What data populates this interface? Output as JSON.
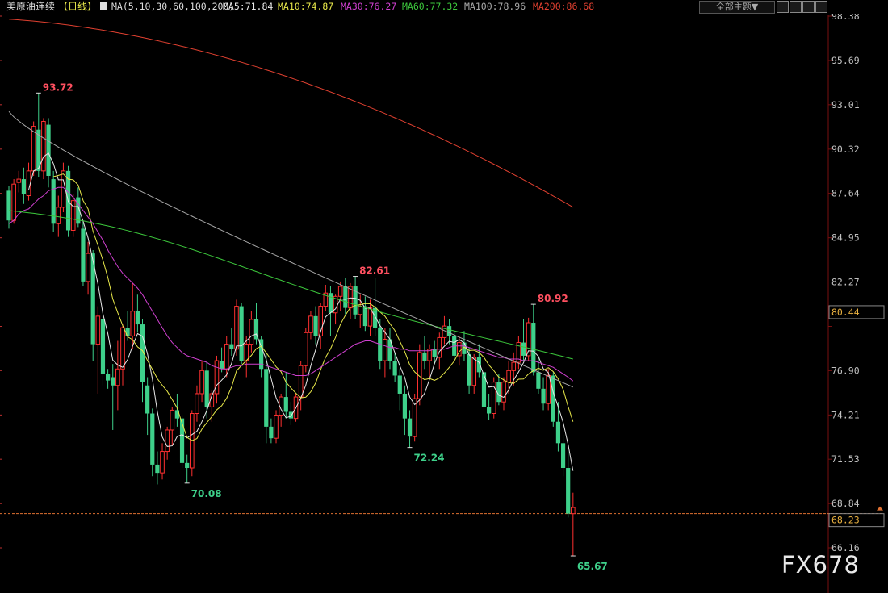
{
  "header": {
    "instrument": "美原油连续",
    "period": "【日线】",
    "ma_label": "MA(5,10,30,60,100,200)",
    "ma_values": [
      {
        "text": "MA5:71.84",
        "color": "#e8e8e8"
      },
      {
        "text": "MA10:74.87",
        "color": "#e8e84a"
      },
      {
        "text": "MA30:76.27",
        "color": "#d040d0"
      },
      {
        "text": "MA60:77.32",
        "color": "#3cc83c"
      },
      {
        "text": "MA100:78.96",
        "color": "#a8a8a8"
      },
      {
        "text": "MA200:86.68",
        "color": "#e04030"
      }
    ],
    "theme_select": "全部主题▼"
  },
  "watermark": "FX678",
  "chart_data": {
    "type": "candlestick",
    "instrument": "美原油连续",
    "period": "日线",
    "ylim": [
      64.5,
      99.5
    ],
    "y_ticks": [
      98.38,
      95.69,
      93.01,
      90.32,
      87.64,
      84.95,
      82.27,
      79.58,
      76.9,
      74.21,
      71.53,
      68.84,
      66.16
    ],
    "y_tick_labels": [
      "98.38",
      "95.69",
      "93.01",
      "90.32",
      "87.64",
      "84.95",
      "82.27",
      "",
      "76.90",
      "74.21",
      "71.53",
      "68.84",
      "66.16"
    ],
    "last_price": 68.23,
    "last_price_label": "68.23",
    "crosshair_price": 80.44,
    "crosshair_label": "80.44",
    "annotations": [
      {
        "label": "93.72",
        "bar": 6,
        "value": 93.72,
        "kind": "high"
      },
      {
        "label": "70.08",
        "bar": 36,
        "value": 70.08,
        "kind": "low"
      },
      {
        "label": "82.61",
        "bar": 70,
        "value": 82.61,
        "kind": "high"
      },
      {
        "label": "72.24",
        "bar": 81,
        "value": 72.24,
        "kind": "low"
      },
      {
        "label": "80.92",
        "bar": 106,
        "value": 80.92,
        "kind": "high"
      },
      {
        "label": "65.67",
        "bar": 114,
        "value": 65.67,
        "kind": "low"
      }
    ],
    "ohlc": [
      [
        87.8,
        88.1,
        85.5,
        86.0
      ],
      [
        86.0,
        88.5,
        85.8,
        88.2
      ],
      [
        88.3,
        89.0,
        87.7,
        88.5
      ],
      [
        88.5,
        89.2,
        87.0,
        87.6
      ],
      [
        87.5,
        89.5,
        87.2,
        89.0
      ],
      [
        89.0,
        92.0,
        88.7,
        91.7
      ],
      [
        91.5,
        93.72,
        88.6,
        89.0
      ],
      [
        89.0,
        92.2,
        88.5,
        92.0
      ],
      [
        91.8,
        92.2,
        88.0,
        88.7
      ],
      [
        88.5,
        89.0,
        85.3,
        85.8
      ],
      [
        85.8,
        87.5,
        85.0,
        86.8
      ],
      [
        86.8,
        89.5,
        86.5,
        89.0
      ],
      [
        89.0,
        89.3,
        85.0,
        85.4
      ],
      [
        85.4,
        87.6,
        85.0,
        87.2
      ],
      [
        87.4,
        88.0,
        85.6,
        85.8
      ],
      [
        85.5,
        86.0,
        82.0,
        82.3
      ],
      [
        82.3,
        84.7,
        81.5,
        84.0
      ],
      [
        84.0,
        84.2,
        77.5,
        78.5
      ],
      [
        78.5,
        80.8,
        75.5,
        80.2
      ],
      [
        80.0,
        80.6,
        76.0,
        76.7
      ],
      [
        76.7,
        77.0,
        75.8,
        76.3
      ],
      [
        76.5,
        77.3,
        73.3,
        76.0
      ],
      [
        76.0,
        78.7,
        74.5,
        77.0
      ],
      [
        77.0,
        79.7,
        76.0,
        79.5
      ],
      [
        79.5,
        80.5,
        78.7,
        79.0
      ],
      [
        79.0,
        82.2,
        78.2,
        80.5
      ],
      [
        80.5,
        81.5,
        79.2,
        79.7
      ],
      [
        79.7,
        80.0,
        75.0,
        76.2
      ],
      [
        76.0,
        76.5,
        73.0,
        74.3
      ],
      [
        74.3,
        74.6,
        70.5,
        71.2
      ],
      [
        71.2,
        72.0,
        70.0,
        70.7
      ],
      [
        70.7,
        72.5,
        70.3,
        72.0
      ],
      [
        72.0,
        73.5,
        71.5,
        73.3
      ],
      [
        73.3,
        74.7,
        72.4,
        74.5
      ],
      [
        74.5,
        75.5,
        73.5,
        74.0
      ],
      [
        74.0,
        74.2,
        71.0,
        71.3
      ],
      [
        71.3,
        71.8,
        70.08,
        71.0
      ],
      [
        71.0,
        74.5,
        70.5,
        74.3
      ],
      [
        74.3,
        76.0,
        73.8,
        75.5
      ],
      [
        75.5,
        77.5,
        75.0,
        76.9
      ],
      [
        76.9,
        77.5,
        74.0,
        74.7
      ],
      [
        74.7,
        75.7,
        73.8,
        75.5
      ],
      [
        75.5,
        77.8,
        74.9,
        77.5
      ],
      [
        77.5,
        78.3,
        76.8,
        77.0
      ],
      [
        77.0,
        79.0,
        76.5,
        78.5
      ],
      [
        78.5,
        79.5,
        77.8,
        78.2
      ],
      [
        78.2,
        81.2,
        77.8,
        80.8
      ],
      [
        80.8,
        81.0,
        77.3,
        77.5
      ],
      [
        77.5,
        79.0,
        76.5,
        78.5
      ],
      [
        78.5,
        80.5,
        78.0,
        80.0
      ],
      [
        80.0,
        81.0,
        78.5,
        78.8
      ],
      [
        78.8,
        79.0,
        76.5,
        77.0
      ],
      [
        77.0,
        78.0,
        72.5,
        73.5
      ],
      [
        73.5,
        74.0,
        72.5,
        72.8
      ],
      [
        72.8,
        74.5,
        72.5,
        74.2
      ],
      [
        74.2,
        75.5,
        73.5,
        75.3
      ],
      [
        75.3,
        76.8,
        74.0,
        74.4
      ],
      [
        74.4,
        75.0,
        73.6,
        74.0
      ],
      [
        74.0,
        75.5,
        73.8,
        75.3
      ],
      [
        75.3,
        77.5,
        74.5,
        77.2
      ],
      [
        77.2,
        79.5,
        76.8,
        79.2
      ],
      [
        79.2,
        80.5,
        78.8,
        80.2
      ],
      [
        80.2,
        80.8,
        78.5,
        79.0
      ],
      [
        79.0,
        81.0,
        78.2,
        80.8
      ],
      [
        80.8,
        82.1,
        80.5,
        81.6
      ],
      [
        81.6,
        82.0,
        79.0,
        80.4
      ],
      [
        80.4,
        81.5,
        79.7,
        81.4
      ],
      [
        81.4,
        82.3,
        80.5,
        82.0
      ],
      [
        82.0,
        82.5,
        80.3,
        80.7
      ],
      [
        80.7,
        82.2,
        80.0,
        82.0
      ],
      [
        82.0,
        82.61,
        80.0,
        80.3
      ],
      [
        80.3,
        81.5,
        79.5,
        80.8
      ],
      [
        80.8,
        81.4,
        79.3,
        79.6
      ],
      [
        79.6,
        81.2,
        79.0,
        80.7
      ],
      [
        80.7,
        82.5,
        79.0,
        79.5
      ],
      [
        79.5,
        80.0,
        77.0,
        77.5
      ],
      [
        77.5,
        79.5,
        76.5,
        78.8
      ],
      [
        78.8,
        79.5,
        77.0,
        77.5
      ],
      [
        77.5,
        78.0,
        76.2,
        76.6
      ],
      [
        76.6,
        77.0,
        74.5,
        75.5
      ],
      [
        75.5,
        76.0,
        73.0,
        74.0
      ],
      [
        74.0,
        74.5,
        72.24,
        72.9
      ],
      [
        72.9,
        75.5,
        72.6,
        75.2
      ],
      [
        75.2,
        78.5,
        74.8,
        78.0
      ],
      [
        78.0,
        79.0,
        77.0,
        77.5
      ],
      [
        77.5,
        78.5,
        76.5,
        78.2
      ],
      [
        78.2,
        78.7,
        77.3,
        77.7
      ],
      [
        77.7,
        79.2,
        77.0,
        78.9
      ],
      [
        78.9,
        80.2,
        78.5,
        79.6
      ],
      [
        79.6,
        80.0,
        78.5,
        79.0
      ],
      [
        79.0,
        79.2,
        77.5,
        77.8
      ],
      [
        77.8,
        79.0,
        77.2,
        78.6
      ],
      [
        78.6,
        79.3,
        77.5,
        77.9
      ],
      [
        77.9,
        78.3,
        75.5,
        76.0
      ],
      [
        76.0,
        77.9,
        75.5,
        77.7
      ],
      [
        77.7,
        78.5,
        76.5,
        76.8
      ],
      [
        76.8,
        77.3,
        74.5,
        74.7
      ],
      [
        74.7,
        75.5,
        73.9,
        74.3
      ],
      [
        74.3,
        76.5,
        74.0,
        76.2
      ],
      [
        76.2,
        76.7,
        74.8,
        75.0
      ],
      [
        75.0,
        76.5,
        74.5,
        76.2
      ],
      [
        76.2,
        77.5,
        75.5,
        76.9
      ],
      [
        76.9,
        78.0,
        76.0,
        77.4
      ],
      [
        77.4,
        79.0,
        77.0,
        78.6
      ],
      [
        78.6,
        80.0,
        77.5,
        77.8
      ],
      [
        77.8,
        80.1,
        77.5,
        79.8
      ],
      [
        79.8,
        80.92,
        76.6,
        76.8
      ],
      [
        76.8,
        77.8,
        75.5,
        75.8
      ],
      [
        75.8,
        76.5,
        74.5,
        74.9
      ],
      [
        74.9,
        77.0,
        74.5,
        76.6
      ],
      [
        76.6,
        76.8,
        73.5,
        73.8
      ],
      [
        73.8,
        75.0,
        72.0,
        72.5
      ],
      [
        72.5,
        73.0,
        70.5,
        71.0
      ],
      [
        71.0,
        72.0,
        68.0,
        68.23
      ],
      [
        68.23,
        69.5,
        65.67,
        68.6
      ]
    ],
    "ma_series": [
      {
        "name": "MA5",
        "color": "#e8e8e8",
        "values": []
      },
      {
        "name": "MA10",
        "color": "#e8e84a",
        "values": []
      },
      {
        "name": "MA30",
        "color": "#d040d0",
        "values": [
          85.8,
          86.0,
          86.4,
          86.6,
          86.7,
          87.0,
          87.3,
          87.5,
          87.8,
          87.9,
          88.0,
          88.0,
          87.7,
          87.4,
          87.0,
          86.6,
          86.2,
          85.8,
          85.3,
          84.8,
          84.2,
          83.7,
          83.2,
          82.8,
          82.5,
          82.2,
          81.9,
          81.5,
          81.0,
          80.5,
          80.0,
          79.5,
          79.0,
          78.6,
          78.3,
          78.0,
          77.8,
          77.7,
          77.6,
          77.5,
          77.4,
          77.2,
          77.1,
          77.0,
          77.0,
          77.1,
          77.2,
          77.2,
          77.3,
          77.3,
          77.3,
          77.3,
          77.2,
          77.1,
          77.0,
          76.9,
          76.8,
          76.7,
          76.6,
          76.6,
          76.6,
          76.7,
          76.9,
          77.1,
          77.3,
          77.5,
          77.7,
          77.9,
          78.1,
          78.3,
          78.5,
          78.6,
          78.7,
          78.7,
          78.6,
          78.5,
          78.4,
          78.3,
          78.3,
          78.2,
          78.2,
          78.1,
          78.1,
          78.1,
          78.1,
          78.1,
          78.2,
          78.2,
          78.2,
          78.3,
          78.4,
          78.4,
          78.4,
          78.3,
          78.2,
          78.1,
          78.0,
          77.9,
          77.8,
          77.7,
          77.7,
          77.6,
          77.6,
          77.6,
          77.5,
          77.5,
          77.5,
          77.4,
          77.3,
          77.2,
          77.1,
          76.9,
          76.7,
          76.5,
          76.27
        ]
      },
      {
        "name": "MA60",
        "color": "#3cc83c",
        "values": []
      },
      {
        "name": "MA100",
        "color": "#a8a8a8",
        "values": []
      },
      {
        "name": "MA200",
        "color": "#e04030",
        "values": []
      }
    ]
  }
}
